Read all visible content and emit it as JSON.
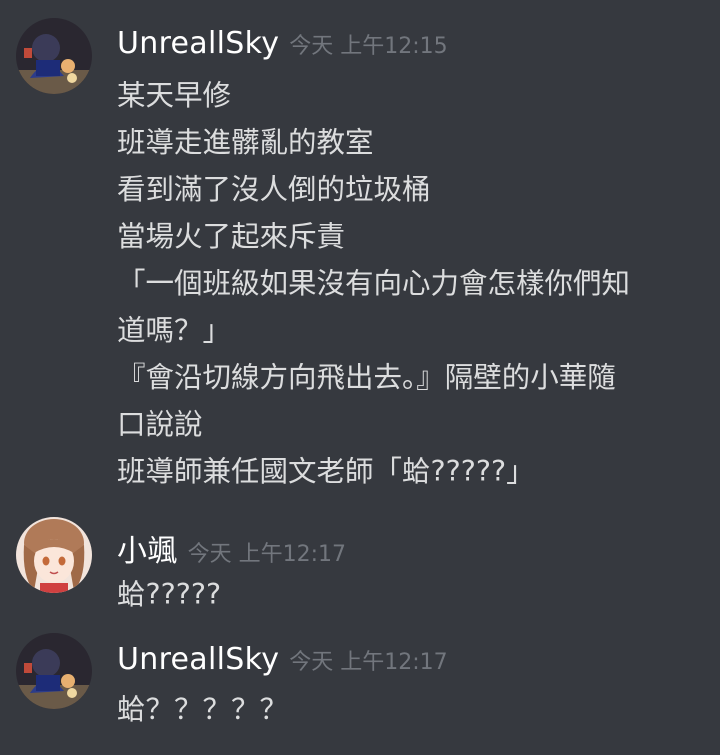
{
  "messages": [
    {
      "username": "UnreallSky",
      "timestamp": "今天 上午12:15",
      "lines": [
        "某天早修",
        "班導走進髒亂的教室",
        "看到滿了沒人倒的垃圾桶",
        "當場火了起來斥責",
        "「一個班級如果沒有向心力會怎樣你們知",
        "道嗎？」",
        "『會沿切線方向飛出去。』隔壁的小華隨",
        "口說說",
        "班導師兼任國文老師「蛤?????」"
      ]
    },
    {
      "username": "小颯",
      "timestamp": "今天 上午12:17",
      "lines": [
        "蛤?????"
      ]
    },
    {
      "username": "UnreallSky",
      "timestamp": "今天 上午12:17",
      "lines": [
        "蛤？？？？？"
      ]
    }
  ]
}
